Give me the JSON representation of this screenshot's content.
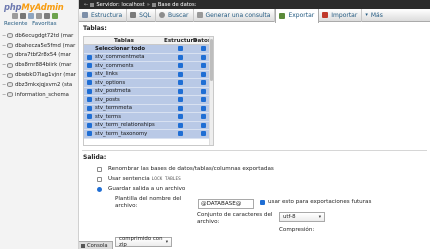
{
  "logo": {
    "part1": "php",
    "part2": "MyAdmin"
  },
  "left_tabs": {
    "recent": "Reciente",
    "favorites": "Favoritas"
  },
  "databases": [
    "db6ecugdgt72td (mar",
    "dbahecza5e5fmd (mar",
    "dbra7tbf2r8x54 (mar",
    "dbs8rnr884biirk (mar",
    "dbwbkO7lag1vjnr (mar",
    "dbz3mkxjqjxvm2 (sta",
    "information_schema"
  ],
  "breadcrumb": {
    "server": "Servidor: localhost",
    "database": "Base de datos:"
  },
  "menu": [
    {
      "label": "Estructura",
      "icon": "structure-icon",
      "color": "#7d8fa8"
    },
    {
      "label": "SQL",
      "icon": "sql-icon",
      "color": "#7a7a7a"
    },
    {
      "label": "Buscar",
      "icon": "search-icon",
      "color": "#8d8d8d"
    },
    {
      "label": "Generar una consulta",
      "icon": "query-icon",
      "color": "#999"
    },
    {
      "label": "Exportar",
      "icon": "export-icon",
      "color": "#5b8a3a"
    },
    {
      "label": "Importar",
      "icon": "import-icon",
      "color": "#c0392b"
    },
    {
      "label": "Más",
      "icon": "more-icon",
      "color": "#235a81"
    }
  ],
  "tables_section": {
    "heading": "Tablas:",
    "col_tables": "Tablas",
    "col_structure": "Estructura",
    "col_data": "Datos",
    "select_all": "Seleccionar todo",
    "rows": [
      "stv_commentmeta",
      "stv_comments",
      "stv_links",
      "stv_options",
      "stv_postmeta",
      "stv_posts",
      "stv_termmeta",
      "stv_terms",
      "stv_term_relationships",
      "stv_term_taxonomy"
    ]
  },
  "output": {
    "heading": "Salida:",
    "rename_option": "Renombrar las bases de datos/tablas/columnas exportadas",
    "use_statement_option": "Usar sentencia",
    "use_statement_code": "LOCK TABLES",
    "save_option": "Guardar salida a un archivo",
    "filename_label_1": "Plantilla del nombre del",
    "filename_label_2": "archivo:",
    "filename_value": "@DATABASE@",
    "future_exports_label": "usar esto para exportaciones futuras",
    "charset_label_1": "Conjunto de caracteres del",
    "charset_label_2": "archivo:",
    "charset_value": "utf-8",
    "compression_label": "Compresión:",
    "compression_value": "comprimido con zip"
  },
  "console": {
    "label": "Consola"
  }
}
